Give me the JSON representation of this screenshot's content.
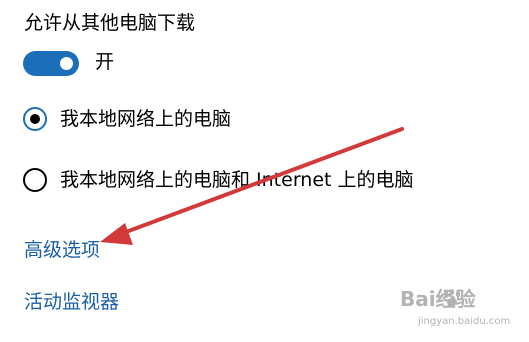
{
  "settings": {
    "title": "允许从其他电脑下载",
    "toggle": {
      "state": "on",
      "label": "开"
    },
    "options": [
      {
        "label": "我本地网络上的电脑",
        "selected": true
      },
      {
        "label": "我本地网络上的电脑和 Internet 上的电脑",
        "selected": false
      }
    ],
    "links": {
      "advanced": "高级选项",
      "activity_monitor": "活动监视器"
    }
  },
  "watermark": {
    "brand_text": "Bai经验",
    "url": "jingyan.baidu.com"
  },
  "colors": {
    "accent": "#1a6fb8",
    "link": "#1a5fa8",
    "arrow": "#d23a3a",
    "text": "#000000"
  },
  "icons": {
    "annotation": "red-arrow-icon",
    "watermark_logo": "baidu-paw-logo-icon"
  }
}
